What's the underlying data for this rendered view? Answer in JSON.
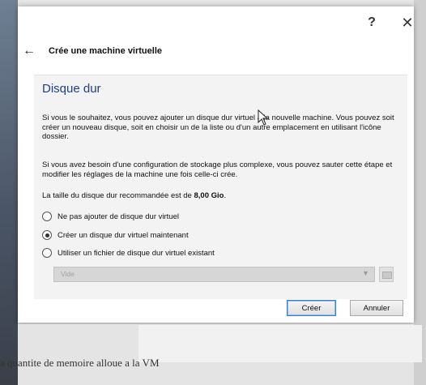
{
  "dialog": {
    "help_label": "?",
    "close_label": "✕",
    "back_label": "←",
    "wizard_title": "Crée une machine virtuelle",
    "page_title": "Disque dur",
    "paragraph1": "Si vous le souhaitez, vous pouvez ajouter un disque dur virtuel à la nouvelle machine. Vous pouvez soit créer un nouveau disque, soit en choisir un de la liste ou d'un autre emplacement en utilisant l'icône dossier.",
    "paragraph2": "Si vous avez besoin d'une configuration de stockage plus complexe, vous pouvez sauter cette étape et modifier les réglages de la machine une fois celle-ci crée.",
    "recommended_prefix": "La taille du disque dur recommandée est de ",
    "recommended_size": "8,00 Gio",
    "recommended_suffix": ".",
    "options": [
      {
        "label": "Ne pas ajouter de disque dur virtuel",
        "checked": false
      },
      {
        "label": "Créer un disque dur virtuel maintenant",
        "checked": true
      },
      {
        "label": "Utiliser un fichier de disque dur virtuel existant",
        "checked": false
      }
    ],
    "existing_disk_select": {
      "value": "Vide",
      "enabled": false
    },
    "create_button": "Créer",
    "cancel_button": "Annuler"
  },
  "background": {
    "partial_text": "a quantite de memoire alloue a la VM"
  },
  "colors": {
    "page_title": "#1d3f8a",
    "default_button_border": "#3c7fd1"
  }
}
